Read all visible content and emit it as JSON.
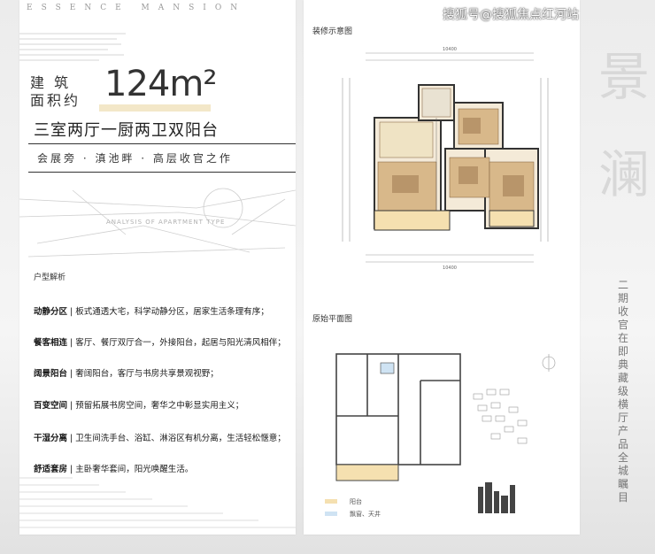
{
  "brand": "ESSENCE MANSION",
  "watermark": "搜狐号@搜狐焦点红河站",
  "area": {
    "label_line1": "建 筑",
    "label_line2": "面积约",
    "value": "124m²"
  },
  "rooms": "三室两厅一厨两卫双阳台",
  "tagline": "会展旁 · 滇池畔 · 高层收官之作",
  "sketch_label": "ANALYSIS OF APARTMENT TYPE",
  "section_title": "户型解析",
  "features": [
    {
      "title": "动静分区",
      "text": "板式通透大宅，科学动静分区，居家生活条理有序；"
    },
    {
      "title": "餐客相连",
      "text": "客厅、餐厅双厅合一，外接阳台，起居与阳光清风相伴；"
    },
    {
      "title": "阔景阳台",
      "text": "奢阔阳台，客厅与书房共享景观视野；"
    },
    {
      "title": "百变空间",
      "text": "预留拓展书房空间，奢华之中彰显实用主义；"
    },
    {
      "title": "干湿分离",
      "text": "卫生间洗手台、浴缸、淋浴区有机分离，生活轻松惬意；"
    },
    {
      "title": "舒适套房",
      "text": "主卧奢华套间，阳光唤醒生活。"
    }
  ],
  "plans": {
    "decorated_title": "装修示意图",
    "original_title": "原始平面图",
    "dim_top": "10400",
    "dim_bottom": "10400",
    "legend": [
      {
        "label": "阳台",
        "color": "#f5e0b0"
      },
      {
        "label": "飘窗、天井",
        "color": "#cfe3f3"
      }
    ]
  },
  "side": {
    "big_chars": [
      "景",
      "澜"
    ],
    "vertical": "二期收官在即 典藏级横厅产品 全城瞩目"
  },
  "colors": {
    "accent": "#f3e7c8",
    "floor_wood": "#c9a778",
    "balcony": "#f5e0b0",
    "window": "#cfe3f3"
  }
}
